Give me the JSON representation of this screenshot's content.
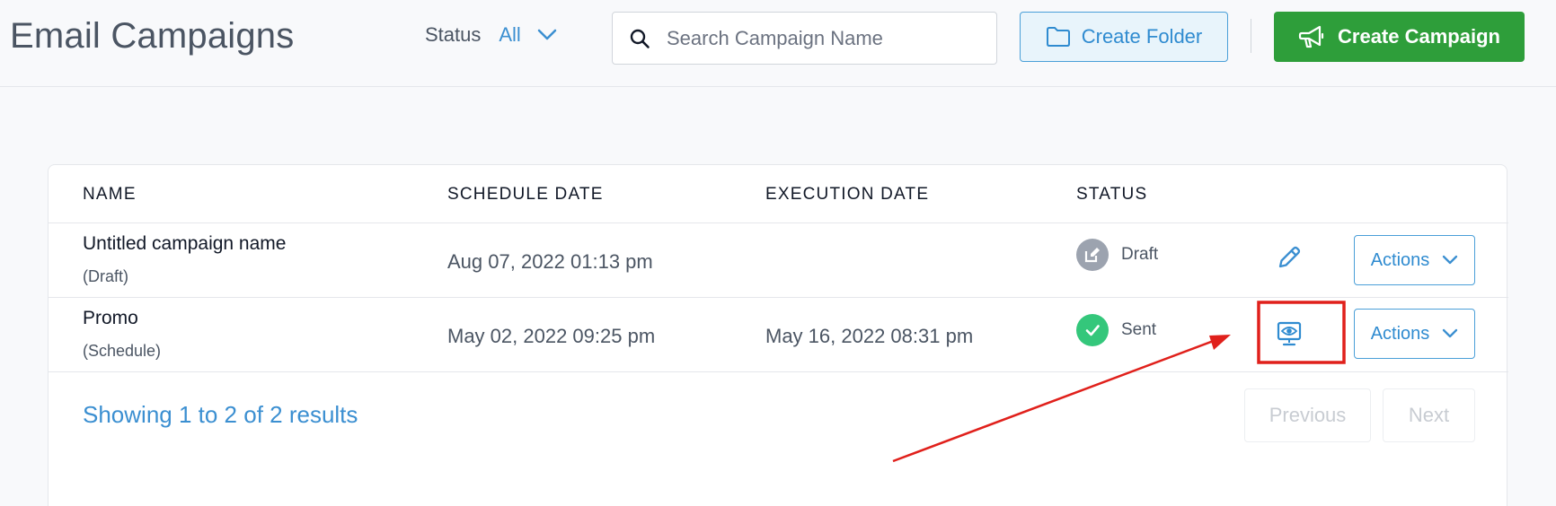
{
  "header": {
    "title": "Email Campaigns",
    "status_label": "Status",
    "status_value": "All",
    "search_placeholder": "Search Campaign Name",
    "create_folder_label": "Create Folder",
    "create_campaign_label": "Create Campaign"
  },
  "table": {
    "columns": [
      "NAME",
      "SCHEDULE DATE",
      "EXECUTION DATE",
      "STATUS"
    ],
    "rows": [
      {
        "name": "Untitled campaign name",
        "sub": "(Draft)",
        "schedule_date": "Aug 07, 2022 01:13 pm",
        "execution_date": "",
        "status": "Draft",
        "row_icon": "pencil-icon",
        "actions_label": "Actions"
      },
      {
        "name": "Promo",
        "sub": "(Schedule)",
        "schedule_date": "May 02, 2022 09:25 pm",
        "execution_date": "May 16, 2022 08:31 pm",
        "status": "Sent",
        "row_icon": "preview-eye-icon",
        "actions_label": "Actions"
      }
    ]
  },
  "footer": {
    "results_text": "Showing 1 to 2 of 2 results",
    "previous_label": "Previous",
    "next_label": "Next"
  },
  "colors": {
    "accent": "#3b8fd1",
    "create_green": "#2e9e3a",
    "draft_gray": "#9ca3af",
    "sent_green": "#34c77b",
    "annotation_red": "#e0201b"
  }
}
